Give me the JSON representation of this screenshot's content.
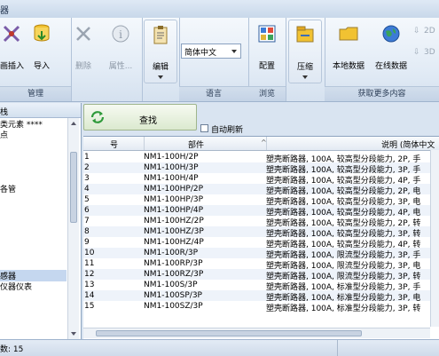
{
  "window": {
    "title_fragment": "器"
  },
  "ribbon": {
    "groups": {
      "manage": "管理",
      "language": "语言",
      "browse": "浏览",
      "more": "获取更多内容"
    },
    "buttons": {
      "insert": "画插入",
      "import": "导入",
      "delete": "删除",
      "properties": "属性...",
      "edit": "编辑",
      "config": "配置",
      "compress": "压缩",
      "local_data": "本地数据",
      "online_data": "在线数据",
      "btn_2d": "2D",
      "btn_3d": "3D"
    },
    "language_select": {
      "value": "简体中文"
    }
  },
  "left_panel": {
    "header": "栈",
    "items": [
      {
        "label": "类元素 ****"
      },
      {
        "label": "点"
      },
      {
        "label": ""
      },
      {
        "label": ""
      },
      {
        "label": ""
      },
      {
        "label": ""
      },
      {
        "label": "各管"
      },
      {
        "label": ""
      },
      {
        "label": ""
      },
      {
        "label": ""
      },
      {
        "label": ""
      },
      {
        "label": ""
      },
      {
        "label": ""
      },
      {
        "label": ""
      },
      {
        "label": "感器"
      },
      {
        "label": "仪器仪表"
      },
      {
        "label": ""
      },
      {
        "label": ""
      },
      {
        "label": ""
      },
      {
        "label": ""
      }
    ]
  },
  "search": {
    "button": "查找",
    "auto_refresh": "自动刷新"
  },
  "table": {
    "columns": [
      "号",
      "部件",
      "说明 (简体中文"
    ],
    "rows": [
      [
        "1",
        "NM1-100H/2P",
        "塑壳断路器, 100A, 较高型分段能力, 2P, 手"
      ],
      [
        "2",
        "NM1-100H/3P",
        "塑壳断路器, 100A, 较高型分段能力, 3P, 手"
      ],
      [
        "3",
        "NM1-100H/4P",
        "塑壳断路器, 100A, 较高型分段能力, 4P, 手"
      ],
      [
        "4",
        "NM1-100HP/2P",
        "塑壳断路器, 100A, 较高型分段能力, 2P, 电"
      ],
      [
        "5",
        "NM1-100HP/3P",
        "塑壳断路器, 100A, 较高型分段能力, 3P, 电"
      ],
      [
        "6",
        "NM1-100HP/4P",
        "塑壳断路器, 100A, 较高型分段能力, 4P, 电"
      ],
      [
        "7",
        "NM1-100HZ/2P",
        "塑壳断路器, 100A, 较高型分段能力, 2P, 转"
      ],
      [
        "8",
        "NM1-100HZ/3P",
        "塑壳断路器, 100A, 较高型分段能力, 3P, 转"
      ],
      [
        "9",
        "NM1-100HZ/4P",
        "塑壳断路器, 100A, 较高型分段能力, 4P, 转"
      ],
      [
        "10",
        "NM1-100R/3P",
        "塑壳断路器, 100A, 限流型分段能力, 3P, 手"
      ],
      [
        "11",
        "NM1-100RP/3P",
        "塑壳断路器, 100A, 限流型分段能力, 3P, 电"
      ],
      [
        "12",
        "NM1-100RZ/3P",
        "塑壳断路器, 100A, 限流型分段能力, 3P, 转"
      ],
      [
        "13",
        "NM1-100S/3P",
        "塑壳断路器, 100A, 标准型分段能力, 3P, 手"
      ],
      [
        "14",
        "NM1-100SP/3P",
        "塑壳断路器, 100A, 标准型分段能力, 3P, 电"
      ],
      [
        "15",
        "NM1-100SZ/3P",
        "塑壳断路器, 100A, 标准型分段能力, 3P, 转"
      ]
    ]
  },
  "status": {
    "text": "数: 15"
  },
  "colors": {
    "accent": "#c5d7ef",
    "ribbon": "#e3ecf6",
    "search": "#dbe9cf"
  }
}
